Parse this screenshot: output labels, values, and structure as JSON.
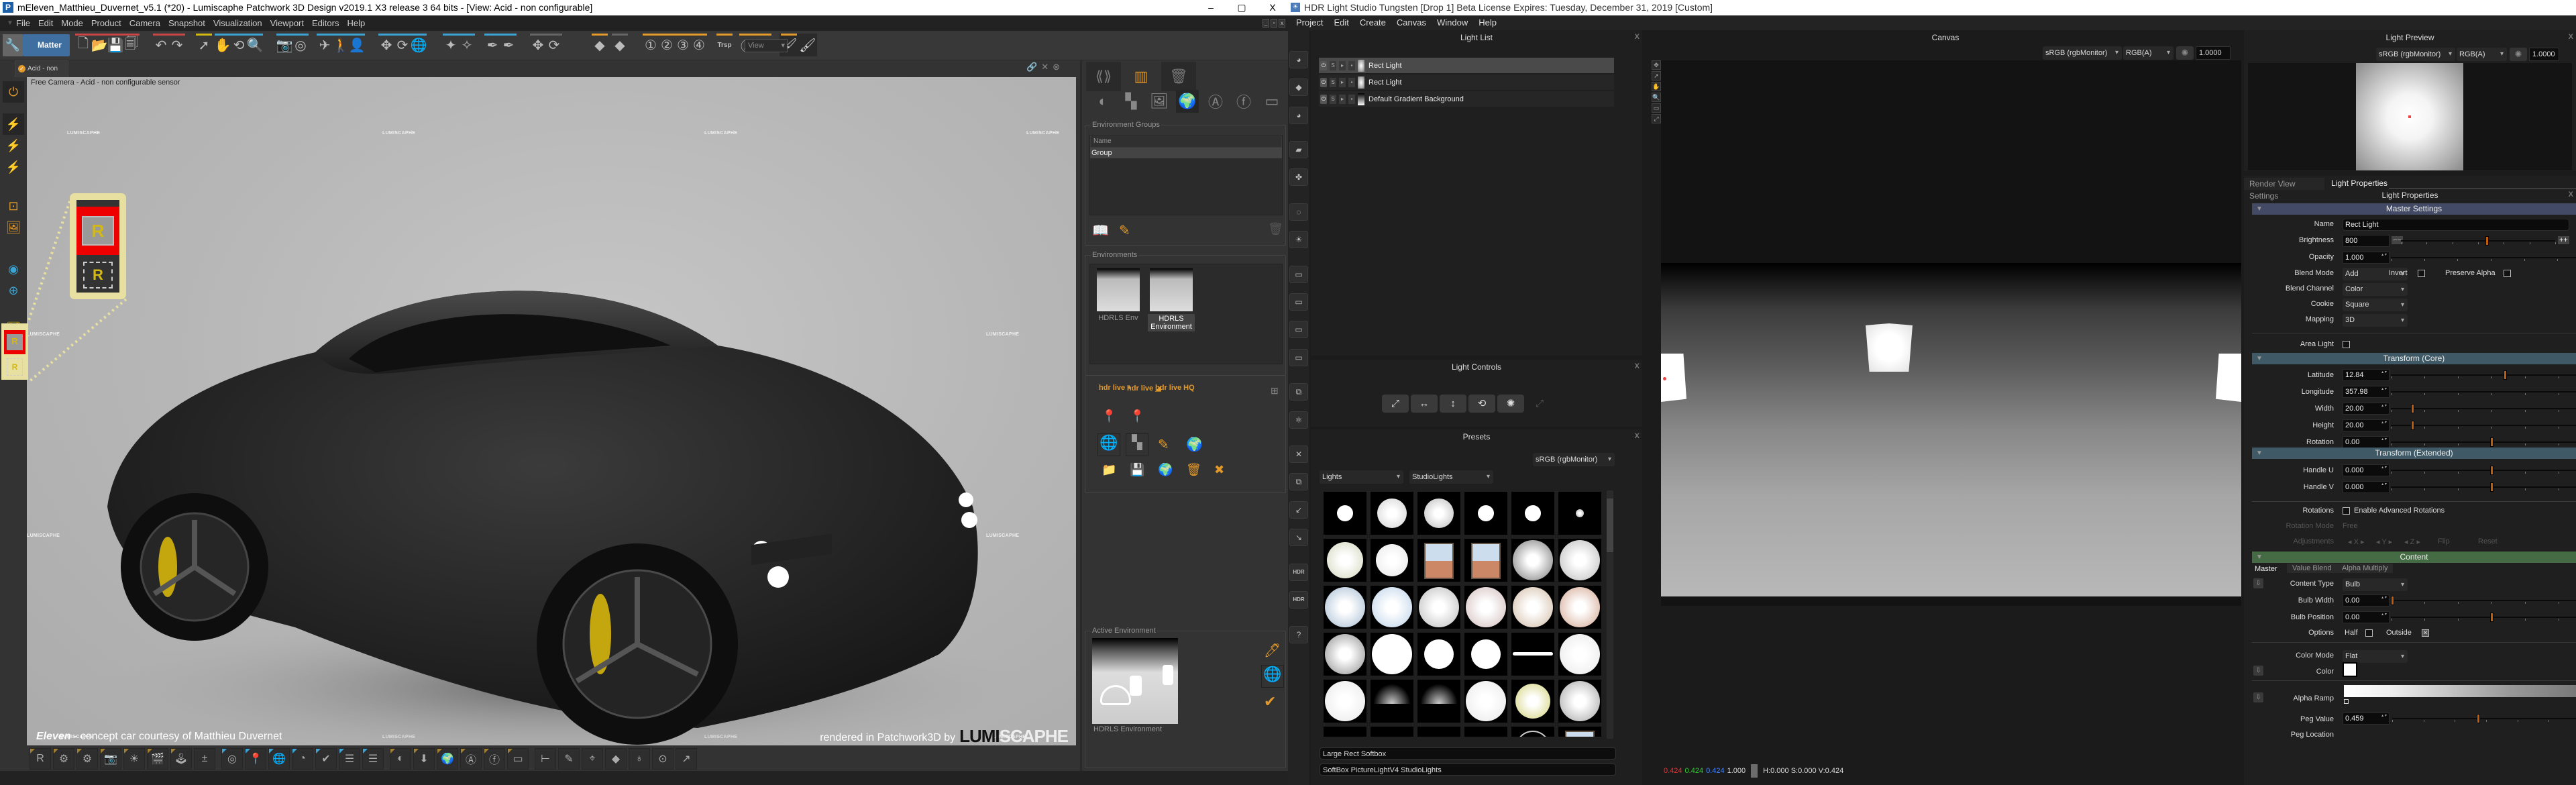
{
  "patchwork": {
    "title": "mEleven_Matthieu_Duvernet_v5.1 (*20) - Lumiscaphe Patchwork 3D Design v2019.1 X3 release 3  64 bits - [View: Acid - non configurable]",
    "app_icon": "P",
    "window_controls": {
      "minimize": "–",
      "maximize": "▢",
      "close": "X"
    },
    "menu": [
      "File",
      "Edit",
      "Mode",
      "Product",
      "Camera",
      "Snapshot",
      "Visualization",
      "Viewport",
      "Editors",
      "Help"
    ],
    "toolbar": {
      "wrench_icon": "wrench-icon",
      "matter_label": "Matter",
      "view_select": "View",
      "buttons": [
        {
          "icon": "new-file-icon",
          "glyph": "🗋",
          "bar": "#c84646"
        },
        {
          "icon": "open-folder-icon",
          "glyph": "📂",
          "bar": "#c84646"
        },
        {
          "icon": "save-icon",
          "glyph": "💾",
          "bar": "#c84646"
        },
        {
          "icon": "save-as-icon",
          "glyph": "🗐",
          "bar": "#c84646"
        },
        {
          "icon": "undo-icon",
          "glyph": "↶",
          "bar": "#c84646"
        },
        {
          "icon": "redo-icon",
          "glyph": "↷",
          "bar": "#c84646"
        },
        {
          "icon": "select-arrow-icon",
          "glyph": "➚",
          "bar": "#d4b814"
        },
        {
          "icon": "pan-hand-icon",
          "glyph": "✋",
          "bar": "#3ba4d4"
        },
        {
          "icon": "orbit-icon",
          "glyph": "⟲",
          "bar": "#3ba4d4"
        },
        {
          "icon": "zoom-icon",
          "glyph": "🔍",
          "bar": "#3ba4d4"
        },
        {
          "icon": "camera-icon",
          "glyph": "📷",
          "bar": "#3ba4d4"
        },
        {
          "icon": "camera-rotate-icon",
          "glyph": "◎",
          "bar": "#3ba4d4"
        },
        {
          "icon": "fly-icon",
          "glyph": "✈",
          "bar": "#3ba4d4"
        },
        {
          "icon": "walk-icon",
          "glyph": "🚶",
          "bar": "#3ba4d4"
        },
        {
          "icon": "person-icon",
          "glyph": "👤",
          "bar": "#3ba4d4"
        },
        {
          "icon": "move-icon",
          "glyph": "✥",
          "bar": "#3ba4d4"
        },
        {
          "icon": "rotate-object-icon",
          "glyph": "⟳",
          "bar": "#3ba4d4"
        },
        {
          "icon": "rotate-world-icon",
          "glyph": "🌐",
          "bar": "#3ba4d4"
        },
        {
          "icon": "pick-material-icon",
          "glyph": "✦",
          "bar": "#3ba4d4"
        },
        {
          "icon": "pick-material-alt-icon",
          "glyph": "✧",
          "bar": "#3ba4d4"
        },
        {
          "icon": "eyedropper-icon",
          "glyph": "✒",
          "bar": "#3ba4d4"
        },
        {
          "icon": "eyedropper-alt-icon",
          "glyph": "✒",
          "bar": "#3ba4d4"
        },
        {
          "icon": "translate-icon",
          "glyph": "✥",
          "bar": "#666"
        },
        {
          "icon": "rotate-icon",
          "glyph": "⟳",
          "bar": "#666"
        },
        {
          "icon": "prev-view-icon",
          "glyph": "◆",
          "bar": "#e39a2a"
        },
        {
          "icon": "next-view-icon",
          "glyph": "◆",
          "bar": "#666"
        },
        {
          "icon": "camera-1-icon",
          "glyph": "①",
          "bar": "#e39a2a"
        },
        {
          "icon": "camera-2-icon",
          "glyph": "②",
          "bar": "#e39a2a"
        },
        {
          "icon": "camera-3-icon",
          "glyph": "③",
          "bar": "#e39a2a"
        },
        {
          "icon": "camera-4-icon",
          "glyph": "④",
          "bar": "#e39a2a"
        },
        {
          "icon": "transparency-icon",
          "glyph": "Trsp",
          "bar": "#e39a2a"
        },
        {
          "icon": "antialiasing-icon",
          "glyph": "Ⓐ",
          "bar": "#e39a2a"
        },
        {
          "icon": "effects-icon",
          "glyph": "ⓕ",
          "bar": "#e39a2a"
        },
        {
          "icon": "paint-brush-icon",
          "glyph": "🖌",
          "bar": "#e39a2a"
        },
        {
          "icon": "paint-brush-active-icon",
          "glyph": "🖌",
          "bar": ""
        }
      ]
    },
    "viewport_tab": "Acid - non configurable",
    "viewport_tab_icons": [
      "link-icon",
      "tools-icon",
      "close-circle-icon"
    ],
    "viewport": {
      "caption": "Free Camera - Acid - non configurable sensor",
      "watermark": "LUMISCAPHE",
      "credit_name": "Eleven",
      "credit_rest": " - concept car courtesy of Matthieu Duvernet",
      "rendered_by": "rendered in Patchwork3D by",
      "logo_a": "LUMI",
      "logo_b": "SCAPHE"
    },
    "left_toolbar": [
      {
        "icon": "realtime-power-icon",
        "glyph": "⏻"
      },
      {
        "icon": "sync-windows-off-icon",
        "glyph": "⚡"
      },
      {
        "icon": "sync-windows-icon",
        "glyph": "⚡"
      },
      {
        "icon": "sync-windows-points-icon",
        "glyph": "⚡"
      },
      {
        "icon": "frame-target-icon",
        "glyph": "⊡"
      },
      {
        "icon": "presentation-icon",
        "glyph": "🖼"
      },
      {
        "icon": "eye-circle-icon",
        "glyph": "◉"
      },
      {
        "icon": "add-circle-icon",
        "glyph": "⊕"
      },
      {
        "icon": "image-icon",
        "glyph": "🏞"
      }
    ],
    "callout_glyph": "R",
    "bottom_toolbar": [
      {
        "icon": "render-r-icon",
        "corner": "#a08030"
      },
      {
        "icon": "snapshot-settings-icon",
        "corner": "#a08030"
      },
      {
        "icon": "render-settings-icon",
        "corner": "#a08030"
      },
      {
        "icon": "camera-settings-icon",
        "corner": "#a08030"
      },
      {
        "icon": "light-icon",
        "corner": "#a08030"
      },
      {
        "icon": "clapper-icon",
        "corner": "#a08030"
      },
      {
        "icon": "joystick-icon",
        "corner": "#a08030"
      },
      {
        "icon": "plus-grid-icon",
        "corner": ""
      },
      {
        "icon": "material-stack-icon",
        "corner": "#3ba4d4"
      },
      {
        "icon": "map-pin-icon",
        "corner": "#3ba4d4"
      },
      {
        "icon": "globe-pin-icon",
        "corner": "#3ba4d4"
      },
      {
        "icon": "shapes-icon",
        "corner": "#3ba4d4"
      },
      {
        "icon": "material-check-icon",
        "corner": "#3ba4d4"
      },
      {
        "icon": "list-brush-icon",
        "corner": "#3ba4d4"
      },
      {
        "icon": "list-icon",
        "corner": "#3ba4d4"
      },
      {
        "icon": "lens-icon",
        "corner": "#a08030"
      },
      {
        "icon": "image-down-icon",
        "corner": "#a08030"
      },
      {
        "icon": "globe-icon",
        "corner": "#a08030"
      },
      {
        "icon": "antialias-icon",
        "corner": "#a08030"
      },
      {
        "icon": "fx-icon",
        "corner": "#a08030"
      },
      {
        "icon": "film-icon",
        "corner": "#a08030"
      },
      {
        "icon": "measure-icon",
        "corner": ""
      },
      {
        "icon": "pencil-line-icon",
        "corner": ""
      },
      {
        "icon": "camera-angle-icon",
        "corner": ""
      },
      {
        "icon": "diamond-icon",
        "corner": ""
      },
      {
        "icon": "lamp-icon",
        "corner": ""
      },
      {
        "icon": "target-arrow-icon",
        "corner": ""
      },
      {
        "icon": "chart-icon",
        "corner": ""
      }
    ],
    "env_panel": {
      "tabs": [
        "sensor-icon",
        "library-icon",
        "trash-library-icon"
      ],
      "category_icons": [
        "lens-icon",
        "checker-icon",
        "image-landscape-icon",
        "globe-icon",
        "antialias-icon",
        "fx-icon",
        "film-icon"
      ],
      "groups_label": "Environment Groups",
      "groups_header": "Name",
      "groups_rows": [
        "Group"
      ],
      "environments_label": "Environments",
      "environments": [
        "HDRLS Env",
        "HDRLS Environment"
      ],
      "hdr_live_buttons": [
        "hdr live +",
        "hdr live ◢",
        "hdr live HQ"
      ],
      "active_label": "Active Environment",
      "active_name": "HDRLS Environment"
    }
  },
  "hdrls": {
    "title": "HDR Light Studio Tungsten [Drop 1] Beta License Expires: Tuesday, December 31, 2019  [Custom]",
    "menu": [
      "Project",
      "Edit",
      "Create",
      "Canvas",
      "Window",
      "Help"
    ],
    "side_tools": [
      "area-light-icon",
      "diamond-light-icon",
      "spot-light-icon",
      "gradient-light-icon",
      "cluster-light-icon",
      "ring-light-icon",
      "sun-light-icon",
      "gradient-background-icon",
      "hdri-background-icon",
      "sky-background-icon",
      "flat-background-icon",
      "group-icon",
      "atom-icon",
      "delete-icon",
      "duplicate-icon",
      "undo-icon",
      "redo-icon",
      "hdr-icon",
      "hdr-refresh-icon",
      "help-icon"
    ],
    "side_tool_labels": {
      "hdr": "HDR",
      "help": "?"
    },
    "light_list": {
      "title": "Light List",
      "rows": [
        {
          "name": "Rect Light",
          "selected": true,
          "thumb": "radial"
        },
        {
          "name": "Rect Light",
          "selected": false,
          "thumb": "radial"
        },
        {
          "name": "Default Gradient Background",
          "selected": false,
          "thumb": "gradient"
        }
      ]
    },
    "light_controls": {
      "title": "Light Controls",
      "buttons": [
        "scale-icon",
        "width-icon",
        "height-icon",
        "rotate-icon",
        "brightness-icon",
        "scale-disabled-icon"
      ]
    },
    "presets": {
      "title": "Presets",
      "color_space": "sRGB (rgbMonitor)",
      "category": "Lights",
      "library": "StudioLights",
      "selected_name": "Large Rect Softbox",
      "selected_path": "SoftBox PictureLightV4 StudioLights"
    },
    "canvas": {
      "title": "Canvas",
      "color_space": "sRGB (rgbMonitor)",
      "channels": "RGB(A)",
      "exposure": "1.0000",
      "tools": [
        "move-icon",
        "select-icon",
        "pan-icon",
        "zoom-icon",
        "zoom-region-icon",
        "zoom-fit-icon"
      ],
      "status": {
        "r": "0.424",
        "g": "0.424",
        "b": "0.424",
        "a": "1.000",
        "hsv": "H:0.000 S:0.000 V:0.424",
        "swatch": "#6c6c6c"
      }
    },
    "light_preview": {
      "title": "Light Preview",
      "color_space": "sRGB (rgbMonitor)",
      "channels": "RGB(A)",
      "exposure": "1.0000"
    },
    "prop_tabs": [
      "Render View Settings",
      "Light Properties"
    ],
    "properties": {
      "title": "Light Properties",
      "master_header": "Master Settings",
      "name_label": "Name",
      "name": "Rect Light",
      "brightness_label": "Brightness",
      "brightness": "800",
      "brightness_pos": 0.56,
      "opacity_label": "Opacity",
      "opacity": "1.000",
      "opacity_pos": 1.0,
      "blend_mode_label": "Blend Mode",
      "blend_mode": "Add",
      "invert_label": "Invert",
      "invert": false,
      "preserve_alpha_label": "Preserve Alpha",
      "preserve_alpha": false,
      "blend_channel_label": "Blend Channel",
      "blend_channel": "Color",
      "cookie_label": "Cookie",
      "cookie": "Square",
      "mapping_label": "Mapping",
      "mapping": "3D",
      "area_light_label": "Area Light",
      "area_light": false,
      "transform_core_header": "Transform (Core)",
      "latitude_label": "Latitude",
      "latitude": "12.84",
      "latitude_pos": 0.571,
      "longitude_label": "Longitude",
      "longitude": "357.98",
      "longitude_pos": 0.994,
      "width_label": "Width",
      "width": "20.00",
      "width_pos": 0.1,
      "height_label": "Height",
      "height": "20.00",
      "height_pos": 0.1,
      "rotation_label": "Rotation",
      "rotation": "0.00",
      "rotation_pos": 0.5,
      "transform_ext_header": "Transform (Extended)",
      "handle_u_label": "Handle U",
      "handle_u": "0.000",
      "handle_u_pos": 0.5,
      "handle_v_label": "Handle V",
      "handle_v": "0.000",
      "handle_v_pos": 0.5,
      "rotations_label": "Rotations",
      "adv_rot_label": "Enable Advanced Rotations",
      "adv_rot": false,
      "rot_mode_label": "Rotation Mode",
      "rot_mode": "Free",
      "adjust_label": "Adjustments",
      "adjust_x": "X",
      "adjust_y": "Y",
      "adjust_z": "Z",
      "flip": "Flip",
      "reset": "Reset",
      "content_header": "Content",
      "content_tabs": [
        "Master",
        "Value Blend",
        "Alpha Multiply"
      ],
      "content_type_label": "Content Type",
      "content_type": "Bulb",
      "bulb_width_label": "Bulb Width",
      "bulb_width": "0.00",
      "bulb_width_pos": 0.0,
      "bulb_position_label": "Bulb Position",
      "bulb_position": "0.00",
      "bulb_position_pos": 0.5,
      "options_label": "Options",
      "half_label": "Half",
      "half": false,
      "outside_label": "Outside",
      "outside": true,
      "color_mode_label": "Color Mode",
      "color_mode": "Flat",
      "color_label": "Color",
      "color": "#ffffff",
      "alpha_ramp_label": "Alpha Ramp",
      "peg_value_label": "Peg Value",
      "peg_value": "0.459",
      "peg_value_pos": 0.459,
      "peg_location_label": "Peg Location"
    },
    "header_colors": {
      "master": "#424a66",
      "transform": "#3f5a66",
      "content": "#456b45"
    }
  }
}
